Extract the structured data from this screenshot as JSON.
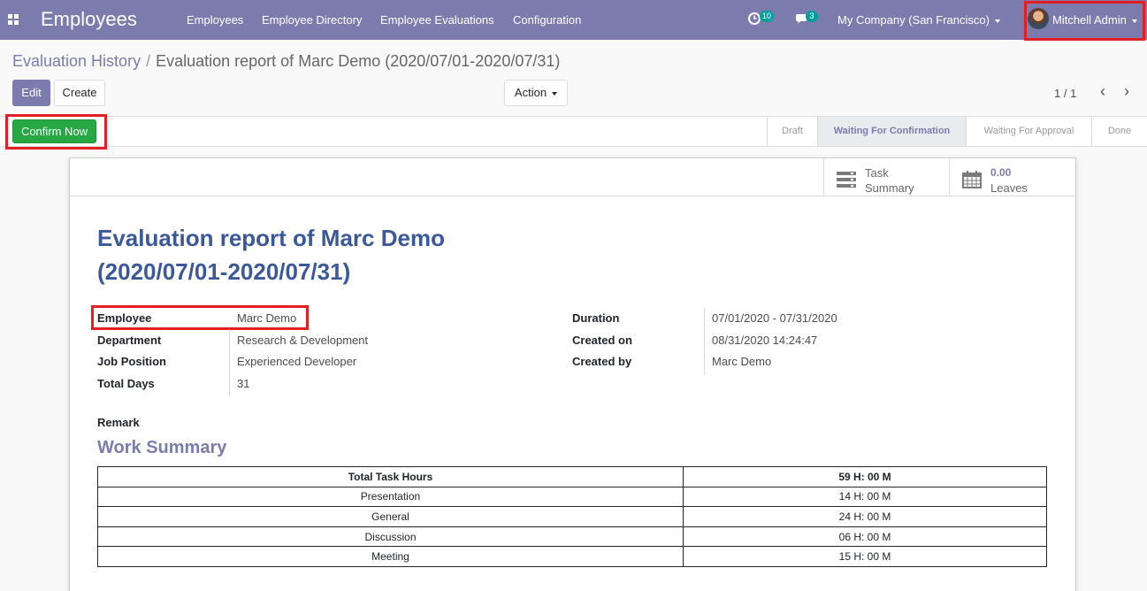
{
  "nav": {
    "app_title": "Employees",
    "menu": [
      "Employees",
      "Employee Directory",
      "Employee Evaluations",
      "Configuration"
    ],
    "activity_count": "10",
    "message_count": "3",
    "company": "My Company (San Francisco)",
    "user": "Mitchell Admin",
    "icons": [
      "apps-grid-icon",
      "activity-clock-icon",
      "chat-icon",
      "user-avatar"
    ]
  },
  "breadcrumb": {
    "parent": "Evaluation History",
    "separator": "/",
    "current": "Evaluation report of Marc Demo (2020/07/01-2020/07/31)"
  },
  "controls": {
    "edit": "Edit",
    "create": "Create",
    "action": "Action",
    "pager": "1 / 1"
  },
  "statusbar": {
    "confirm": "Confirm Now",
    "stages": [
      "Draft",
      "Waiting For Confirmation",
      "Waiting For Approval",
      "Done"
    ],
    "active_stage": "Waiting For Confirmation"
  },
  "smart_buttons": {
    "task_line1": "Task",
    "task_line2": "Summary",
    "leaves_value": "0.00",
    "leaves_label": "Leaves"
  },
  "form": {
    "title_line1": "Evaluation report of Marc Demo",
    "title_line2": "(2020/07/01-2020/07/31)",
    "left": [
      {
        "label": "Employee",
        "value": "Marc Demo"
      },
      {
        "label": "Department",
        "value": "Research & Development"
      },
      {
        "label": "Job Position",
        "value": "Experienced Developer"
      },
      {
        "label": "Total Days",
        "value": "31"
      }
    ],
    "right": [
      {
        "label": "Duration",
        "value": "07/01/2020 - 07/31/2020"
      },
      {
        "label": "Created on",
        "value": "08/31/2020 14:24:47"
      },
      {
        "label": "Created by",
        "value": "Marc Demo"
      }
    ],
    "remark_label": "Remark",
    "work_summary_title": "Work Summary"
  },
  "work_summary": {
    "header": {
      "task": "Total Task Hours",
      "hours": "59 H: 00 M"
    },
    "rows": [
      {
        "task": "Presentation",
        "hours": "14 H: 00 M"
      },
      {
        "task": "General",
        "hours": "24 H: 00 M"
      },
      {
        "task": "Discussion",
        "hours": "06 H: 00 M"
      },
      {
        "task": "Meeting",
        "hours": "15 H: 00 M"
      }
    ]
  },
  "colors": {
    "brand": "#7c7bad",
    "title": "#3b5898",
    "confirm": "#28a745",
    "highlight": "#e31e24"
  }
}
